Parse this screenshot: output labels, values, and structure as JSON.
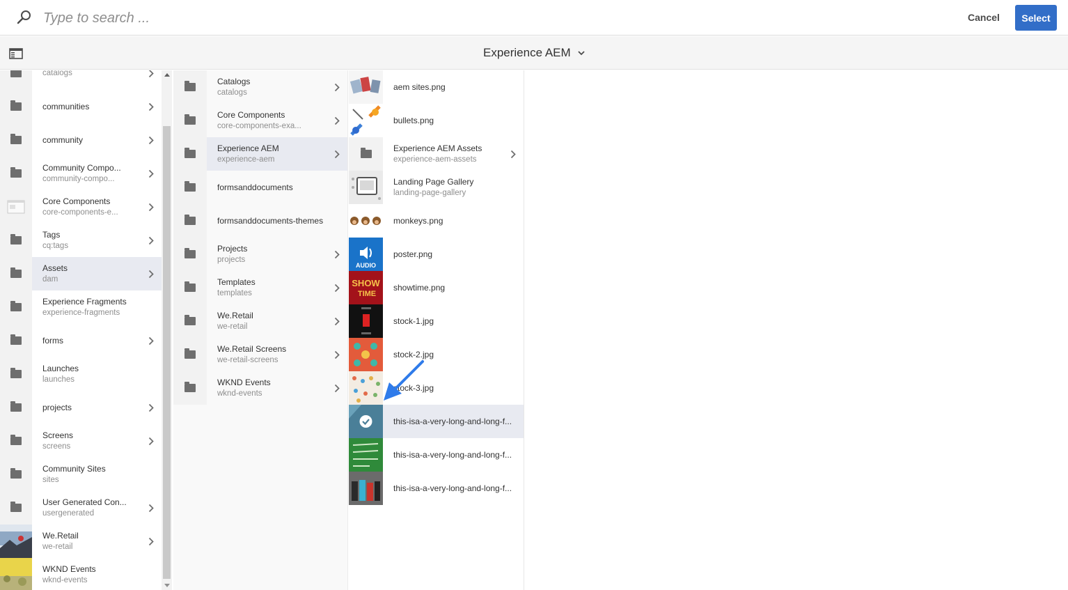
{
  "search": {
    "placeholder": "Type to search ..."
  },
  "actions": {
    "cancel_label": "Cancel",
    "select_label": "Select"
  },
  "header": {
    "title": "Experience AEM"
  },
  "column1": [
    {
      "name": "",
      "sub": "catalogs",
      "thumb": "folder",
      "chevron": true
    },
    {
      "name": "communities",
      "sub": "",
      "thumb": "folder",
      "chevron": true
    },
    {
      "name": "community",
      "sub": "",
      "thumb": "folder",
      "chevron": true
    },
    {
      "name": "Community Compo...",
      "sub": "community-compo...",
      "thumb": "folder",
      "chevron": true
    },
    {
      "name": "Core Components",
      "sub": "core-components-e...",
      "thumb": "page",
      "chevron": true
    },
    {
      "name": "Tags",
      "sub": "cq:tags",
      "thumb": "folder",
      "chevron": true
    },
    {
      "name": "Assets",
      "sub": "dam",
      "thumb": "folder",
      "chevron": true,
      "selected": true
    },
    {
      "name": "Experience Fragments",
      "sub": "experience-fragments",
      "thumb": "folder",
      "chevron": false
    },
    {
      "name": "forms",
      "sub": "",
      "thumb": "folder",
      "chevron": true
    },
    {
      "name": "Launches",
      "sub": "launches",
      "thumb": "folder",
      "chevron": false
    },
    {
      "name": "projects",
      "sub": "",
      "thumb": "folder",
      "chevron": true
    },
    {
      "name": "Screens",
      "sub": "screens",
      "thumb": "folder",
      "chevron": true
    },
    {
      "name": "Community Sites",
      "sub": "sites",
      "thumb": "folder",
      "chevron": false
    },
    {
      "name": "User Generated Con...",
      "sub": "usergenerated",
      "thumb": "folder",
      "chevron": true
    },
    {
      "name": "We.Retail",
      "sub": "we-retail",
      "thumb": "photo-retail",
      "chevron": true
    },
    {
      "name": "WKND Events",
      "sub": "wknd-events",
      "thumb": "photo-wknd",
      "chevron": false
    }
  ],
  "column2": [
    {
      "name": "Catalogs",
      "sub": "catalogs",
      "chevron": true
    },
    {
      "name": "Core Components",
      "sub": "core-components-exa...",
      "chevron": true
    },
    {
      "name": "Experience AEM",
      "sub": "experience-aem",
      "chevron": true,
      "selected": true
    },
    {
      "name": "formsanddocuments",
      "sub": "",
      "chevron": false
    },
    {
      "name": "formsanddocuments-themes",
      "sub": "",
      "chevron": false
    },
    {
      "name": "Projects",
      "sub": "projects",
      "chevron": true
    },
    {
      "name": "Templates",
      "sub": "templates",
      "chevron": true
    },
    {
      "name": "We.Retail",
      "sub": "we-retail",
      "chevron": true
    },
    {
      "name": "We.Retail Screens",
      "sub": "we-retail-screens",
      "chevron": true
    },
    {
      "name": "WKND Events",
      "sub": "wknd-events",
      "chevron": true
    }
  ],
  "column3": [
    {
      "name": "aem sites.png",
      "sub": "",
      "thumb": "aem-sites"
    },
    {
      "name": "bullets.png",
      "sub": "",
      "thumb": "bullets"
    },
    {
      "name": "Experience AEM Assets",
      "sub": "experience-aem-assets",
      "thumb": "folder",
      "chevron": true
    },
    {
      "name": "Landing Page Gallery",
      "sub": "landing-page-gallery",
      "thumb": "gallery"
    },
    {
      "name": "monkeys.png",
      "sub": "",
      "thumb": "monkeys"
    },
    {
      "name": "poster.png",
      "sub": "",
      "thumb": "audio",
      "thumb_text": "AUDIO"
    },
    {
      "name": "showtime.png",
      "sub": "",
      "thumb": "showtime",
      "thumb_text": "SHOW TIME"
    },
    {
      "name": "stock-1.jpg",
      "sub": "",
      "thumb": "stock1"
    },
    {
      "name": "stock-2.jpg",
      "sub": "",
      "thumb": "stock2"
    },
    {
      "name": "stock-3.jpg",
      "sub": "",
      "thumb": "stock3"
    },
    {
      "name": "this-isa-a-very-long-and-long-f...",
      "sub": "",
      "thumb": "checked",
      "selected": true
    },
    {
      "name": "this-isa-a-very-long-and-long-f...",
      "sub": "",
      "thumb": "green"
    },
    {
      "name": "this-isa-a-very-long-and-long-f...",
      "sub": "",
      "thumb": "boots"
    }
  ],
  "colors": {
    "accent": "#326ec8",
    "selected_row": "#e8eaf1",
    "annotation_arrow": "#2f7bea"
  }
}
